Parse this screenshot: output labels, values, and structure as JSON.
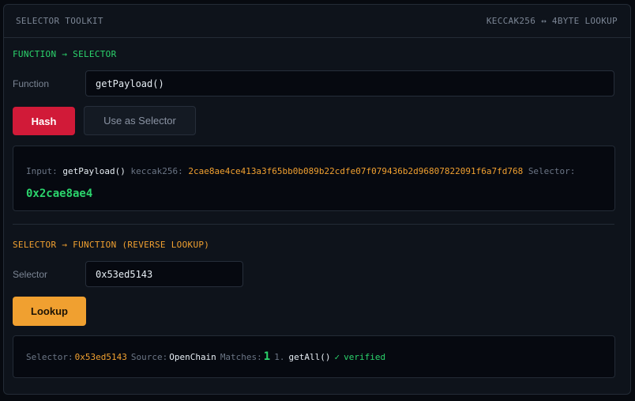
{
  "header": {
    "title": "SELECTOR TOOLKIT",
    "subtitle": "KECCAK256 ↔ 4BYTE LOOKUP"
  },
  "forward": {
    "section_title": "FUNCTION → SELECTOR",
    "field_label": "Function",
    "input_value": "getPayload()",
    "hash_button": "Hash",
    "use_as_selector_button": "Use as Selector",
    "result": {
      "input_label": "Input:",
      "input_value": "getPayload()",
      "keccak_label": "keccak256:",
      "keccak_value": "2cae8ae4ce413a3f65bb0b089b22cdfe07f079436b2d96807822091f6a7fd768",
      "selector_label": "Selector:",
      "selector_value": "0x2cae8ae4"
    }
  },
  "reverse": {
    "section_title": "SELECTOR → FUNCTION (REVERSE LOOKUP)",
    "field_label": "Selector",
    "input_value": "0x53ed5143",
    "lookup_button": "Lookup",
    "result": {
      "selector_label": "Selector:",
      "selector_value": "0x53ed5143",
      "source_label": "Source:",
      "source_value": "OpenChain",
      "matches_label": "Matches:",
      "matches_count": "1",
      "match_index": "1.",
      "match_signature": "getAll()",
      "verified_icon": "✓",
      "verified_text": "verified"
    }
  },
  "colors": {
    "accent_green": "#2bd46c",
    "accent_orange": "#f0a030",
    "hash_red": "#d11a38"
  }
}
